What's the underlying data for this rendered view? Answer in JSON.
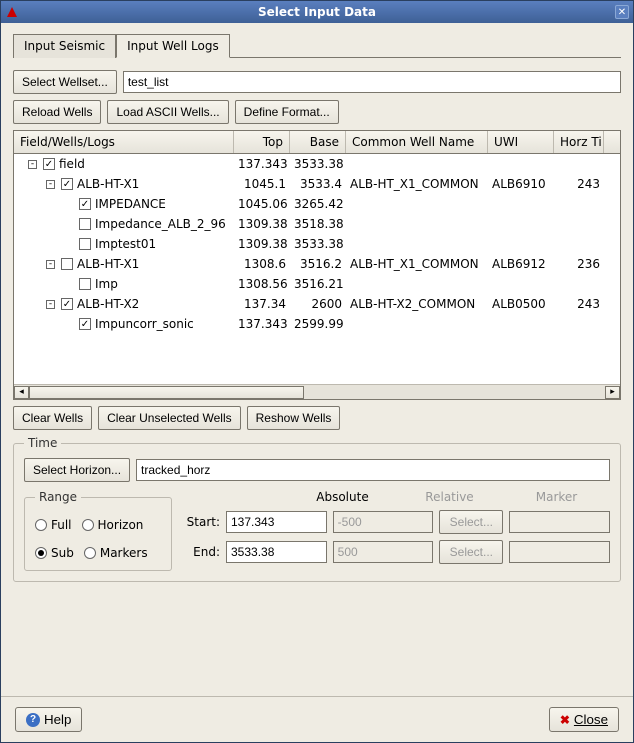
{
  "window": {
    "title": "Select Input Data"
  },
  "tabs": {
    "seismic": "Input Seismic",
    "well_logs": "Input Well Logs"
  },
  "buttons": {
    "select_wellset": "Select Wellset...",
    "reload_wells": "Reload Wells",
    "load_ascii": "Load ASCII Wells...",
    "define_format": "Define Format...",
    "clear_wells": "Clear Wells",
    "clear_unselected": "Clear Unselected Wells",
    "reshow_wells": "Reshow Wells",
    "select_horizon": "Select Horizon...",
    "select_marker": "Select...",
    "help": "Help",
    "close": "Close"
  },
  "inputs": {
    "wellset_name": "test_list",
    "horizon_name": "tracked_horz",
    "abs_start": "137.343",
    "abs_end": "3533.38",
    "rel_start": "-500",
    "rel_end": "500"
  },
  "table": {
    "headers": {
      "tree": "Field/Wells/Logs",
      "top": "Top",
      "base": "Base",
      "common": "Common Well Name",
      "uwi": "UWI",
      "horz": "Horz Ti"
    },
    "rows": [
      {
        "indent": 0,
        "exp": "-",
        "checked": true,
        "label": "field",
        "top": "137.343",
        "base": "3533.38",
        "common": "",
        "uwi": "",
        "horz": ""
      },
      {
        "indent": 1,
        "exp": "-",
        "checked": true,
        "label": "ALB-HT-X1",
        "top": "1045.1",
        "base": "3533.4",
        "common": "ALB-HT_X1_COMMON",
        "uwi": "ALB6910",
        "horz": "243"
      },
      {
        "indent": 2,
        "exp": "",
        "checked": true,
        "label": "IMPEDANCE",
        "top": "1045.06",
        "base": "3265.42",
        "common": "",
        "uwi": "",
        "horz": ""
      },
      {
        "indent": 2,
        "exp": "",
        "checked": false,
        "label": "Impedance_ALB_2_96",
        "top": "1309.38",
        "base": "3518.38",
        "common": "",
        "uwi": "",
        "horz": ""
      },
      {
        "indent": 2,
        "exp": "",
        "checked": false,
        "label": "Imptest01",
        "top": "1309.38",
        "base": "3533.38",
        "common": "",
        "uwi": "",
        "horz": ""
      },
      {
        "indent": 1,
        "exp": "-",
        "checked": false,
        "label": "ALB-HT-X1",
        "top": "1308.6",
        "base": "3516.2",
        "common": "ALB-HT_X1_COMMON",
        "uwi": "ALB6912",
        "horz": "236"
      },
      {
        "indent": 2,
        "exp": "",
        "checked": false,
        "label": "Imp",
        "top": "1308.56",
        "base": "3516.21",
        "common": "",
        "uwi": "",
        "horz": ""
      },
      {
        "indent": 1,
        "exp": "-",
        "checked": true,
        "label": "ALB-HT-X2",
        "top": "137.34",
        "base": "2600",
        "common": "ALB-HT-X2_COMMON",
        "uwi": "ALB0500",
        "horz": "243"
      },
      {
        "indent": 2,
        "exp": "",
        "checked": true,
        "label": "Impuncorr_sonic",
        "top": "137.343",
        "base": "2599.99",
        "common": "",
        "uwi": "",
        "horz": ""
      }
    ]
  },
  "time": {
    "legend": "Time",
    "range_legend": "Range",
    "radios": {
      "full": "Full",
      "horizon": "Horizon",
      "sub": "Sub",
      "markers": "Markers"
    },
    "cols": {
      "absolute": "Absolute",
      "relative": "Relative",
      "marker": "Marker"
    },
    "labels": {
      "start": "Start:",
      "end": "End:"
    }
  }
}
